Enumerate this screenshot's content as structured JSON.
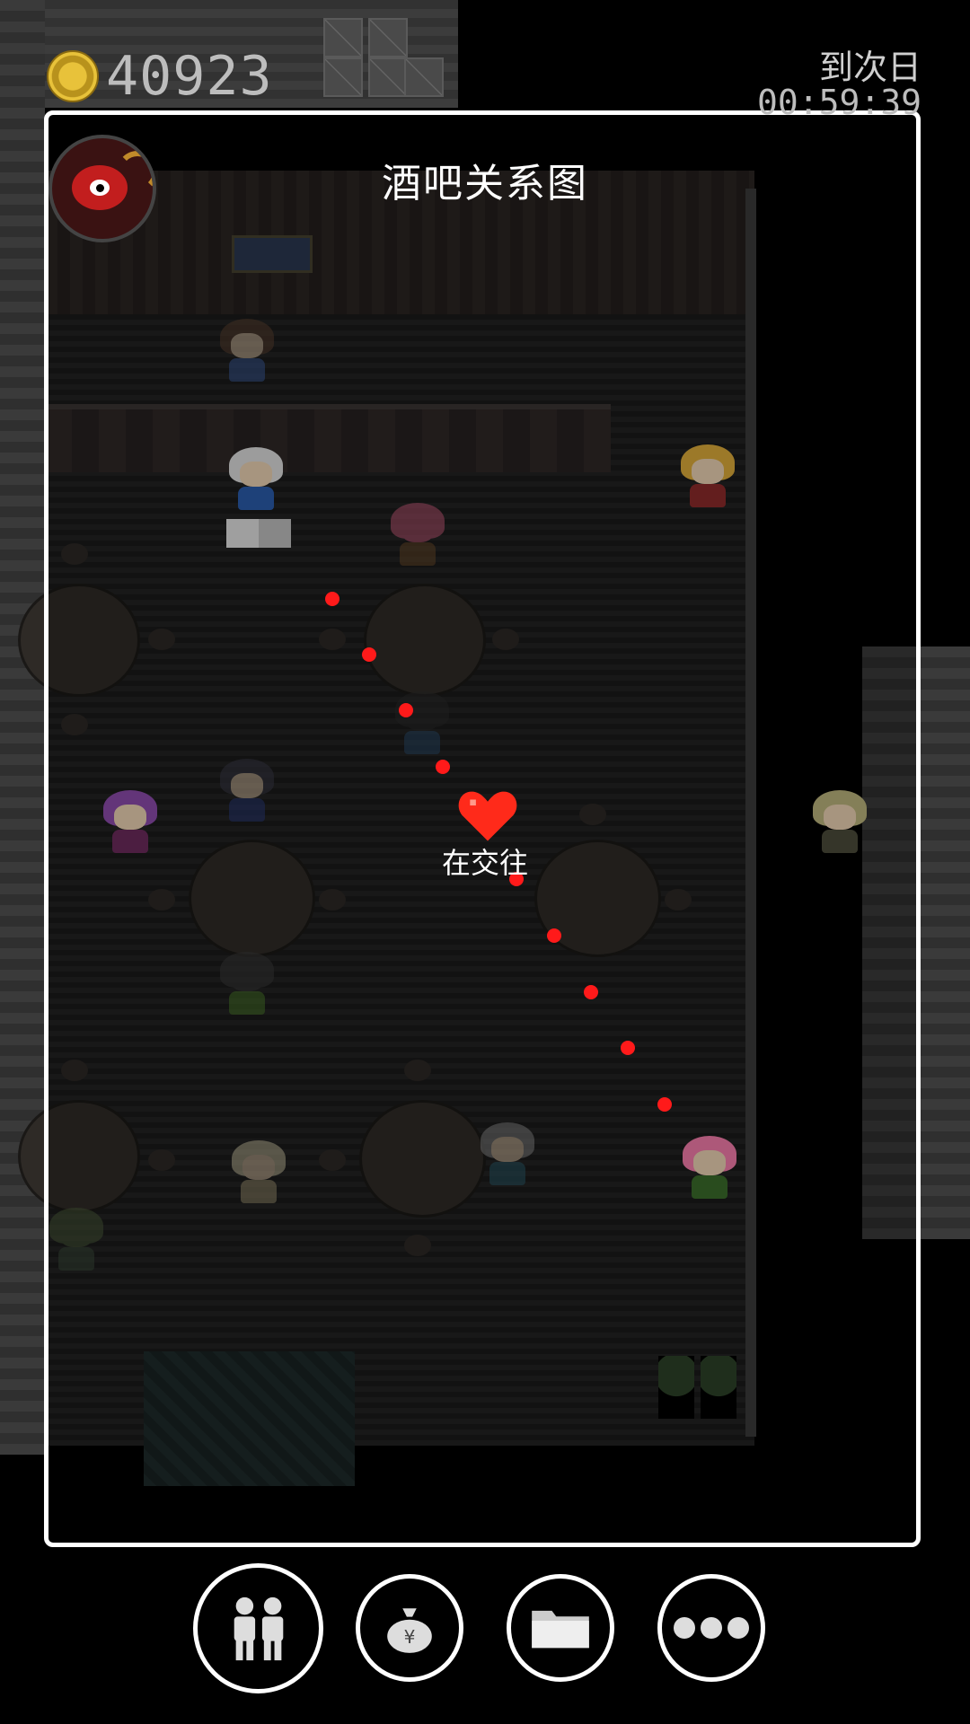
{
  "hud": {
    "gold": "40923",
    "next_day_label": "到次日",
    "countdown": "00:59:39"
  },
  "panel": {
    "title": "酒吧关系图"
  },
  "relationship": {
    "status_label": "在交往",
    "color": "#ff1a1a"
  },
  "bottom_bar": {
    "buttons": [
      {
        "icon": "people-icon"
      },
      {
        "icon": "money-bag-icon"
      },
      {
        "icon": "folder-icon"
      },
      {
        "icon": "more-icon"
      }
    ]
  },
  "colors": {
    "frame": "#ffffff",
    "coin": "#e8c23a",
    "heart": "#ff2a1a"
  }
}
